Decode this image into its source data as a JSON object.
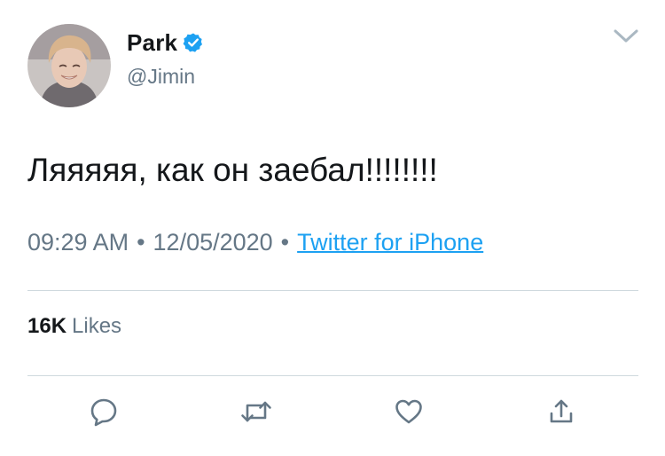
{
  "author": {
    "display_name": "Park",
    "handle": "@Jimin",
    "verified": true,
    "avatar_icon": "user-avatar"
  },
  "tweet": {
    "text": "Ляяяяя, как он заебал!!!!!!!!"
  },
  "meta": {
    "time": "09:29 AM",
    "separator": "•",
    "date": "12/05/2020",
    "source": "Twitter for iPhone"
  },
  "stats": {
    "likes_count": "16K",
    "likes_label": "Likes"
  },
  "icons": {
    "more": "chevron-down-icon",
    "reply": "reply-icon",
    "retweet": "retweet-icon",
    "like": "heart-icon",
    "share": "share-icon"
  },
  "colors": {
    "text": "#14171a",
    "secondary": "#657786",
    "link": "#1da1f2",
    "icon": "#657786",
    "divider": "#cfd9de"
  }
}
